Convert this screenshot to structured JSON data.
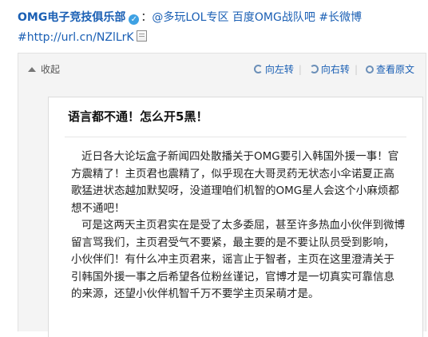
{
  "post": {
    "author": "OMG电子竞技俱乐部",
    "verified_mark": "✓",
    "colon": "：",
    "mention": "@多玩LOL专区",
    "mention2": "百度OMG战队吧",
    "hashtag": "#长微博",
    "url": "#http://url.cn/NZlLrK"
  },
  "media": {
    "collapse_label": "收起",
    "tools": {
      "rotate_left": "向左转",
      "rotate_right": "向右转",
      "view_original": "查看原文"
    }
  },
  "image": {
    "title": "语言都不通！怎么开5黑！",
    "lines": [
      "近日各大论坛盒子新闻四处散播关于OMG要引入韩国外援一事！官",
      "方震精了！主页君也震精了，似乎现在大哥灵药无状态小伞诺夏正高",
      "歌猛进状态越加默契呀，没道理咱们机智的OMG星人会这个小麻烦都",
      "想不通吧！",
      "可是这两天主页君实在是受了太多委屈，甚至许多热血小伙伴到微博",
      "留言骂我们，主页君受气不要紧，最主要的是不要让队员受到影响，",
      "小伙伴们！有什么冲主页君来，谣言止于智者，主页在这里澄清关于",
      "引韩国外援一事之后希望各位粉丝谨记，官博才是一切真实可靠信息",
      "的来源，还望小伙伴机智千万不要学主页呆萌才是。"
    ]
  }
}
